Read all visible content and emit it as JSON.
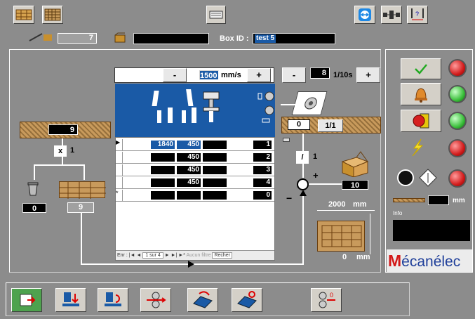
{
  "header": {
    "counter_value": "7",
    "box_id_label": "Box ID :",
    "box_id_value": "test 5"
  },
  "speed": {
    "minus": "-",
    "value": "1500",
    "unit": "mm/s",
    "plus": "+"
  },
  "time": {
    "minus": "-",
    "value": "8",
    "unit": "1/10s",
    "plus": "+"
  },
  "left": {
    "stack_count": "9",
    "multiplier": "x",
    "multiplier_value": "1",
    "waste_count": "0",
    "output_count": "9"
  },
  "right_flow": {
    "zero_field": "0",
    "fraction_button": "1/1",
    "divide_sign": "/",
    "divide_value": "1",
    "plus_sign": "+",
    "minus_sign": "−",
    "add_value": "10",
    "width_value": "2000",
    "width_unit": "mm",
    "depth_value": "0",
    "depth_unit": "mm"
  },
  "grid": {
    "rows": [
      {
        "c1": "1840",
        "c2": "450",
        "c3": "",
        "c4": "1"
      },
      {
        "c1": "",
        "c2": "450",
        "c3": "",
        "c4": "2"
      },
      {
        "c1": "",
        "c2": "450",
        "c3": "",
        "c4": "3"
      },
      {
        "c1": "",
        "c2": "450",
        "c3": "",
        "c4": "4"
      },
      {
        "c1": "",
        "c2": "",
        "c3": "",
        "c4": "0"
      }
    ],
    "nav": {
      "record_label": "Enr :",
      "record_pos": "1 sur 4",
      "filter_label": "Aucun filtre",
      "search_label": "Recher"
    }
  },
  "right_panel": {
    "mm_value": "",
    "mm_unit": "mm",
    "info_label": "Info",
    "info_value": "",
    "logo_m": "M",
    "logo_rest": "écanélec"
  },
  "colors": {
    "accent_blue": "#1a5aa6",
    "field_black": "#000000",
    "logo_blue": "#1f3f9a"
  }
}
